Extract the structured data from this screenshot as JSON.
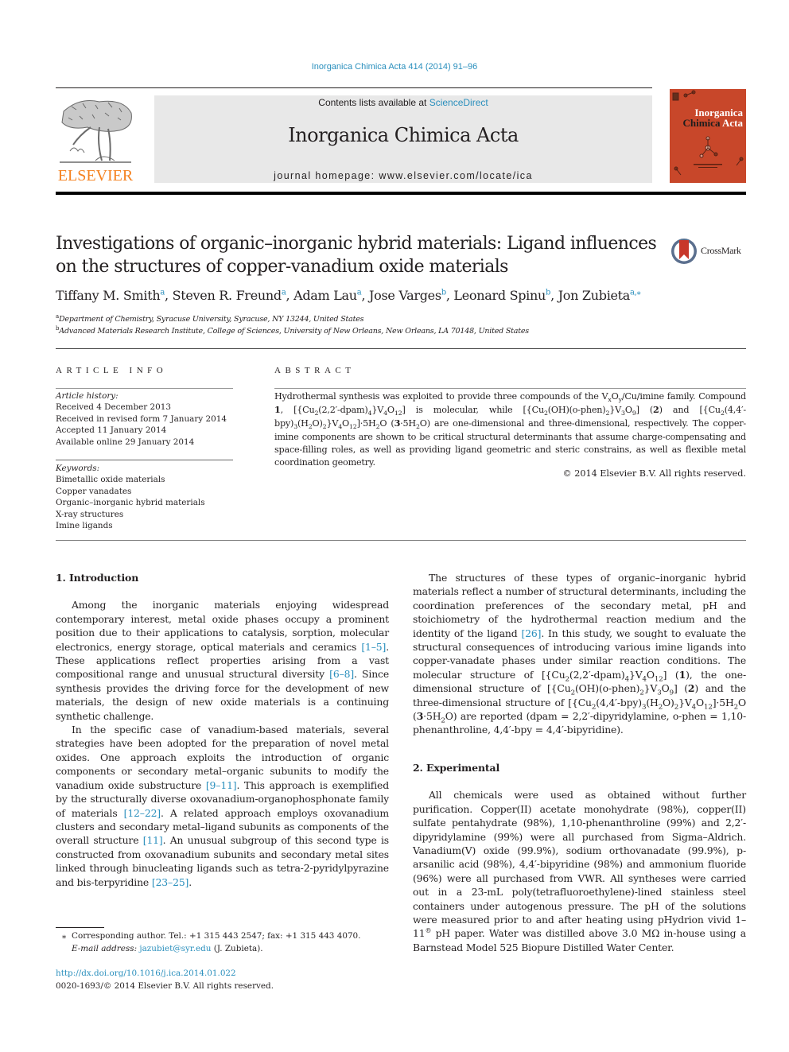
{
  "header": {
    "citation": "Inorganica Chimica Acta 414 (2014) 91–96",
    "contents_prefix": "Contents lists available at ",
    "contents_link": "ScienceDirect",
    "journal_title": "Inorganica Chimica Acta",
    "homepage": "journal homepage: www.elsevier.com/locate/ica",
    "publisher_logo_text": "ELSEVIER",
    "cover_title_line1": "Inorganica",
    "cover_title_line2a": "Chimica",
    "cover_title_line2b": "Acta",
    "brand_colors": {
      "link": "#2a8fbd",
      "elsevier_orange": "#f58220",
      "cover_red": "#c8472a"
    }
  },
  "article": {
    "title": "Investigations of organic–inorganic hybrid materials: Ligand influences on the structures of copper-vanadium oxide materials",
    "crossmark_label": "CrossMark",
    "authors": [
      {
        "name": "Tiffany M. Smith",
        "aff": "a"
      },
      {
        "name": "Steven R. Freund",
        "aff": "a"
      },
      {
        "name": "Adam Lau",
        "aff": "a"
      },
      {
        "name": "Jose Varges",
        "aff": "b"
      },
      {
        "name": "Leonard Spinu",
        "aff": "b"
      },
      {
        "name": "Jon Zubieta",
        "aff": "a,⁎"
      }
    ],
    "affiliations": [
      {
        "key": "a",
        "text": "Department of Chemistry, Syracuse University, Syracuse, NY 13244, United States"
      },
      {
        "key": "b",
        "text": "Advanced Materials Research Institute, College of Sciences, University of New Orleans, New Orleans, LA 70148, United States"
      }
    ]
  },
  "article_info": {
    "heading": "ARTICLE INFO",
    "history_label": "Article history:",
    "history": [
      "Received 4 December 2013",
      "Received in revised form 7 January 2014",
      "Accepted 11 January 2014",
      "Available online 29 January 2014"
    ],
    "keywords_label": "Keywords:",
    "keywords": [
      "Bimetallic oxide materials",
      "Copper vanadates",
      "Organic–inorganic hybrid materials",
      "X-ray structures",
      "Imine ligands"
    ]
  },
  "abstract": {
    "heading": "ABSTRACT",
    "text_1": "Hydrothermal synthesis was exploited to provide three compounds of the V",
    "text_2": "/Cu/imine family. Compound ",
    "text_3": " is molecular, while ",
    "text_4": " and ",
    "text_5": " are one-dimensional and three-dimensional, respectively. The copper-imine components are shown to be critical structural determinants that assume charge-compensating and space-filling roles, as well as providing ligand geometric and steric constrains, as well as flexible metal coordination geometry.",
    "copyright": "© 2014 Elsevier B.V. All rights reserved."
  },
  "body": {
    "intro_heading": "1. Introduction",
    "intro_p1_a": "Among the inorganic materials enjoying widespread contemporary interest, metal oxide phases occupy a prominent position due to their applications to catalysis, sorption, molecular electronics, energy storage, optical materials and ceramics ",
    "ref_1_5": "[1–5]",
    "intro_p1_b": ". These applications reflect properties arising from a vast compositional range and unusual structural diversity ",
    "ref_6_8": "[6–8]",
    "intro_p1_c": ". Since synthesis provides the driving force for the development of new materials, the design of new oxide materials is a continuing synthetic challenge.",
    "intro_p2_a": "In the specific case of vanadium-based materials, several strategies have been adopted for the preparation of novel metal oxides. One approach exploits the introduction of organic components or secondary metal–organic subunits to modify the vanadium oxide substructure ",
    "ref_9_11": "[9–11]",
    "intro_p2_b": ". This approach is exemplified by the structurally diverse oxovanadium-organophosphonate family of materials ",
    "ref_12_22": "[12–22]",
    "intro_p2_c": ". A related approach employs oxovanadium clusters and secondary metal–ligand subunits as components of the overall structure ",
    "ref_11": "[11]",
    "intro_p2_d": ". An unusual subgroup of this second type is constructed from oxovanadium subunits and secondary metal sites linked through binucleating ligands such as tetra-2-pyridylpyrazine and bis-terpyridine ",
    "ref_23_25": "[23–25]",
    "intro_p2_e": ".",
    "intro_p3_a": "The structures of these types of organic–inorganic hybrid materials reflect a number of structural determinants, including the coordination preferences of the secondary metal, pH and stoichiometry of the hydrothermal reaction medium and the identity of the ligand ",
    "ref_26": "[26]",
    "intro_p3_b": ". In this study, we sought to evaluate the structural consequences of introducing various imine ligands into copper-vanadate phases under similar reaction conditions. The molecular structure of ",
    "intro_p3_c": ", the one-dimensional structure of ",
    "intro_p3_d": " and the three-dimensional structure of ",
    "intro_p3_e": " are reported (dpam = 2,2′-dipyridylamine, o-phen = 1,10-phenanthroline, 4,4′-bpy = 4,4′-bipyridine).",
    "exp_heading": "2. Experimental",
    "exp_p1_a": "All chemicals were used as obtained without further purification. Copper(II) acetate monohydrate (98%), copper(II) sulfate pentahydrate (98%), 1,10-phenanthroline (99%) and 2,2′-dipyridylamine (99%) were all purchased from Sigma–Aldrich. Vanadium(V) oxide (99.9%), sodium orthovanadate (99.9%), p-arsanilic acid (98%), 4,4′-bipyridine (98%) and ammonium fluoride (96%) were all purchased from VWR. All syntheses were carried out in a 23-mL poly(tetrafluoroethylene)-lined stainless steel containers under autogenous pressure. The pH of the solutions were measured prior to and after heating using pHydrion vivid 1–11",
    "exp_p1_b": " pH paper. Water was distilled above 3.0 MΩ in-house using a Barnstead Model 525 Biopure Distilled Water Center.",
    "registered_mark": "®"
  },
  "compounds": {
    "c1_num": "1",
    "c2_num": "2",
    "c3_num": "3"
  },
  "footnote": {
    "marker": "⁎",
    "corresponding": "Corresponding author. Tel.: +1 315 443 2547; fax: +1 315 443 4070.",
    "email_label": "E-mail address:",
    "email": "jazubiet@syr.edu",
    "email_suffix": " (J. Zubieta).",
    "doi": "http://dx.doi.org/10.1016/j.ica.2014.01.022",
    "issn_line": "0020-1693/© 2014 Elsevier B.V. All rights reserved."
  }
}
